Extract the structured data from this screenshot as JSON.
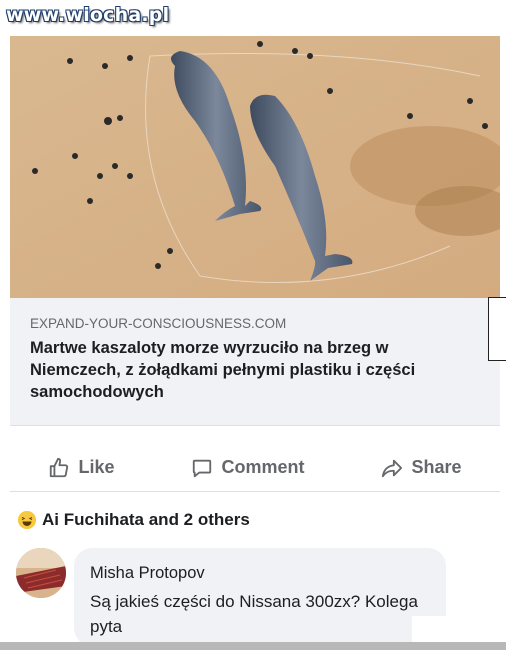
{
  "watermark": "www.wiocha.pl",
  "photo": {
    "alt": "two-sperm-whales-on-beach"
  },
  "link_preview": {
    "domain": "EXPAND-YOUR-CONSCIOUSNESS.COM",
    "title": "Martwe kaszaloty morze wyrzuciło na brzeg w Niemczech, z żołądkami pełnymi plastiku i części samochodowych"
  },
  "actions": {
    "like": "Like",
    "comment": "Comment",
    "share": "Share"
  },
  "reactions": {
    "icon": "laughing-emoji-icon",
    "text": "Ai Fuchihata and 2 others"
  },
  "comment": {
    "author": "Misha Protopov",
    "text": "Są jakieś części do Nissana 300zx? Kolega pyta"
  },
  "colors": {
    "secondary_text": "#65676b",
    "primary_text": "#1c1e21",
    "card_bg": "#f0f2f5",
    "sand": "#d8b48c"
  }
}
